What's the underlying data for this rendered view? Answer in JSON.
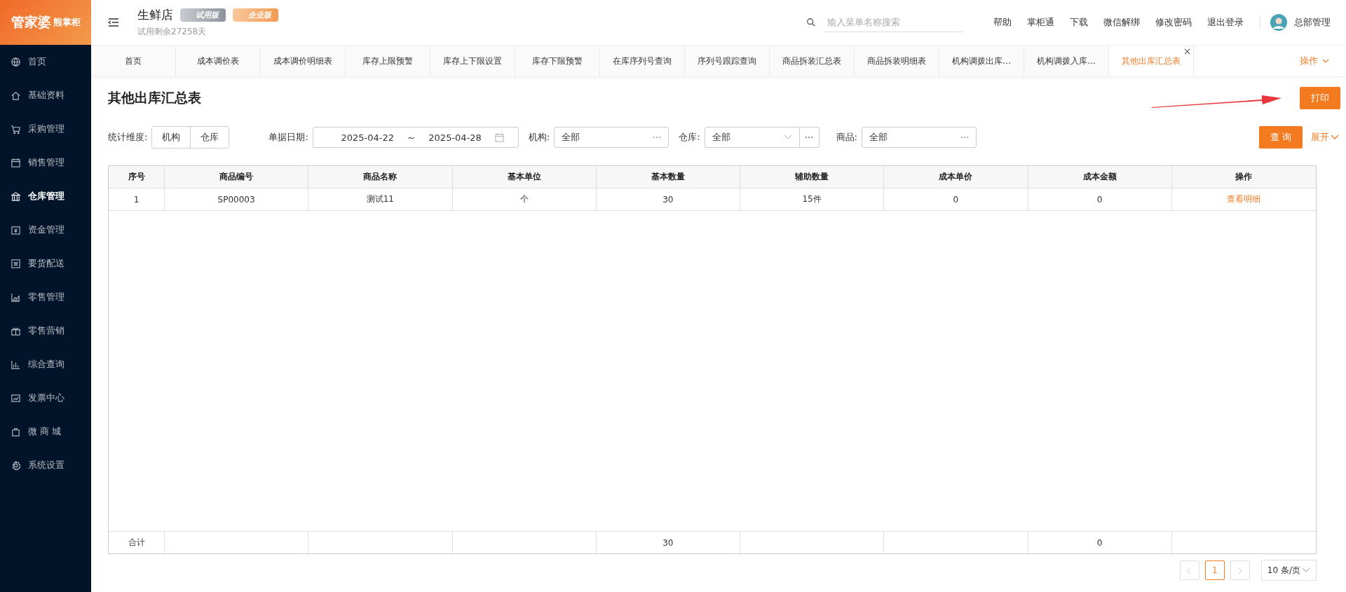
{
  "logo": {
    "brand": "管家婆",
    "product": "熊掌柜"
  },
  "header": {
    "store": "生鲜店",
    "badges": [
      "试用版",
      "企业版"
    ],
    "trial_note": "试用剩余27258天",
    "search": {
      "placeholder": "输入菜单名称搜索"
    },
    "links": [
      "帮助",
      "掌柜通",
      "下载",
      "微信解绑",
      "修改密码",
      "退出登录"
    ],
    "user": "总部管理"
  },
  "sidebar": {
    "items": [
      {
        "label": "首页",
        "selected": false
      },
      {
        "label": "基础资料",
        "selected": false
      },
      {
        "label": "采购管理",
        "selected": false
      },
      {
        "label": "销售管理",
        "selected": false
      },
      {
        "label": "仓库管理",
        "selected": true
      },
      {
        "label": "资金管理",
        "selected": false
      },
      {
        "label": "要货配送",
        "selected": false
      },
      {
        "label": "零售管理",
        "selected": false
      },
      {
        "label": "零售营销",
        "selected": false
      },
      {
        "label": "综合查询",
        "selected": false
      },
      {
        "label": "发票中心",
        "selected": false
      },
      {
        "label": "微 商 城",
        "selected": false
      },
      {
        "label": "系统设置",
        "selected": false
      }
    ]
  },
  "tabs": [
    {
      "label": "首页",
      "selected": false
    },
    {
      "label": "成本调价表",
      "selected": false
    },
    {
      "label": "成本调价明细表",
      "selected": false
    },
    {
      "label": "库存上限预警",
      "selected": false
    },
    {
      "label": "库存上下限设置",
      "selected": false
    },
    {
      "label": "库存下限预警",
      "selected": false
    },
    {
      "label": "在库序列号查询",
      "selected": false
    },
    {
      "label": "序列号跟踪查询",
      "selected": false
    },
    {
      "label": "商品拆装汇总表",
      "selected": false
    },
    {
      "label": "商品拆装明细表",
      "selected": false
    },
    {
      "label": "机构调拨出库…",
      "selected": false
    },
    {
      "label": "机构调拨入库…",
      "selected": false
    },
    {
      "label": "其他出库汇总表",
      "selected": true
    }
  ],
  "tab_actions": "操作",
  "page": {
    "title": "其他出库汇总表",
    "print_button": "打印"
  },
  "filters": {
    "dimension": {
      "label": "统计维度:",
      "options": [
        "机构",
        "仓库"
      ]
    },
    "date": {
      "label": "单据日期:",
      "from": "2025-04-22",
      "separator": "~",
      "to": "2025-04-28"
    },
    "org": {
      "label": "机构:",
      "value": "全部"
    },
    "warehouse": {
      "label": "仓库:",
      "value": "全部"
    },
    "product": {
      "label": "商品:",
      "value": "全部"
    },
    "query_button": "查 询",
    "expand_link": "展开"
  },
  "table": {
    "columns": [
      "序号",
      "商品编号",
      "商品名称",
      "基本单位",
      "基本数量",
      "辅助数量",
      "成本单价",
      "成本金额",
      "操作"
    ],
    "rows": [
      [
        "1",
        "SP00003",
        "测试11",
        "个",
        "30",
        "15件",
        "0",
        "0",
        "查看明细"
      ]
    ],
    "totals": {
      "label": "合计",
      "basic_quantity": "30",
      "cost_amount": "0"
    }
  },
  "pagination": {
    "current": "1",
    "page_size": "10 条/页"
  }
}
